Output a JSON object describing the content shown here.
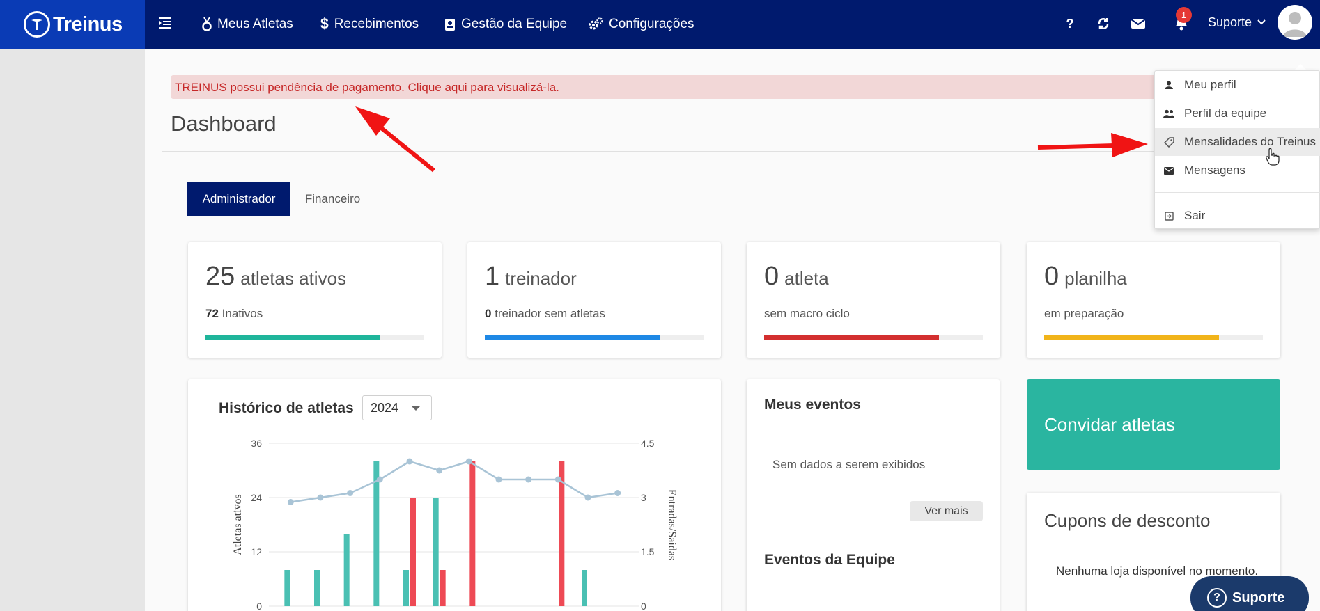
{
  "brand": {
    "name": "Treinus"
  },
  "nav": {
    "items": [
      {
        "label": "Meus Atletas"
      },
      {
        "label": "Recebimentos"
      },
      {
        "label": "Gestão da Equipe"
      },
      {
        "label": "Configurações"
      }
    ],
    "help_glyph": "?",
    "notifications_count": "1",
    "user_label": "Suporte"
  },
  "alert": {
    "text": "TREINUS possui pendência de pagamento. Clique aqui para visualizá-la."
  },
  "page": {
    "title": "Dashboard"
  },
  "tabs": [
    {
      "label": "Administrador",
      "active": true
    },
    {
      "label": "Financeiro",
      "active": false
    }
  ],
  "stats": [
    {
      "value": "25",
      "label": "atletas ativos",
      "sub_value": "72",
      "sub_text": "Inativos",
      "progress": 0.8,
      "color": "#1fb59b"
    },
    {
      "value": "1",
      "label": "treinador",
      "sub_value": "0",
      "sub_text": "treinador sem atletas",
      "progress": 0.8,
      "color": "#1e88e5"
    },
    {
      "value": "0",
      "label": "atleta",
      "sub_value": "",
      "sub_text": "sem macro ciclo",
      "progress": 0.8,
      "color": "#d32f2f"
    },
    {
      "value": "0",
      "label": "planilha",
      "sub_value": "",
      "sub_text": "em preparação",
      "progress": 0.8,
      "color": "#f1b41a"
    }
  ],
  "history": {
    "title": "Histórico de atletas",
    "year": "2024"
  },
  "chart_data": {
    "type": "bar",
    "ylabel": "Atletas ativos",
    "y2label": "Entradas/Saídas",
    "ylim": [
      0,
      36
    ],
    "y2lim": [
      0,
      4.5
    ],
    "yticks": [
      "0",
      "12",
      "24",
      "36"
    ],
    "y2ticks": [
      "0",
      "1.5",
      "3",
      "4.5"
    ],
    "grid": true,
    "line": {
      "name": "Atletas ativos",
      "color": "#a9c4d6",
      "values": [
        23,
        24,
        25,
        28,
        32,
        30,
        32,
        28,
        28,
        28,
        24,
        25
      ]
    },
    "series": [
      {
        "name": "Entradas",
        "color": "#4ac0b3",
        "values": [
          1,
          1,
          2,
          4,
          1,
          3,
          0,
          0,
          0,
          0,
          1,
          0
        ]
      },
      {
        "name": "Saídas",
        "color": "#ee4a55",
        "values": [
          0,
          0,
          0,
          0,
          3,
          1,
          4,
          0,
          0,
          4,
          0,
          0
        ]
      }
    ]
  },
  "events": {
    "title": "Meus eventos",
    "empty": "Sem dados a serem exibidos",
    "more": "Ver mais",
    "team_title": "Eventos da Equipe"
  },
  "invite": {
    "label": "Convidar atletas"
  },
  "coupons": {
    "title": "Cupons de desconto",
    "empty": "Nenhuma loja disponível no momento."
  },
  "support": {
    "label": "Suporte",
    "glyph": "?"
  },
  "dropdown": {
    "items": [
      {
        "label": "Meu perfil",
        "icon": "person-icon"
      },
      {
        "label": "Perfil da equipe",
        "icon": "people-icon"
      },
      {
        "label": "Mensalidades do Treinus",
        "icon": "tag-icon"
      },
      {
        "label": "Mensagens",
        "icon": "envelope-icon"
      },
      {
        "label": "Sair",
        "icon": "logout-icon"
      }
    ]
  }
}
